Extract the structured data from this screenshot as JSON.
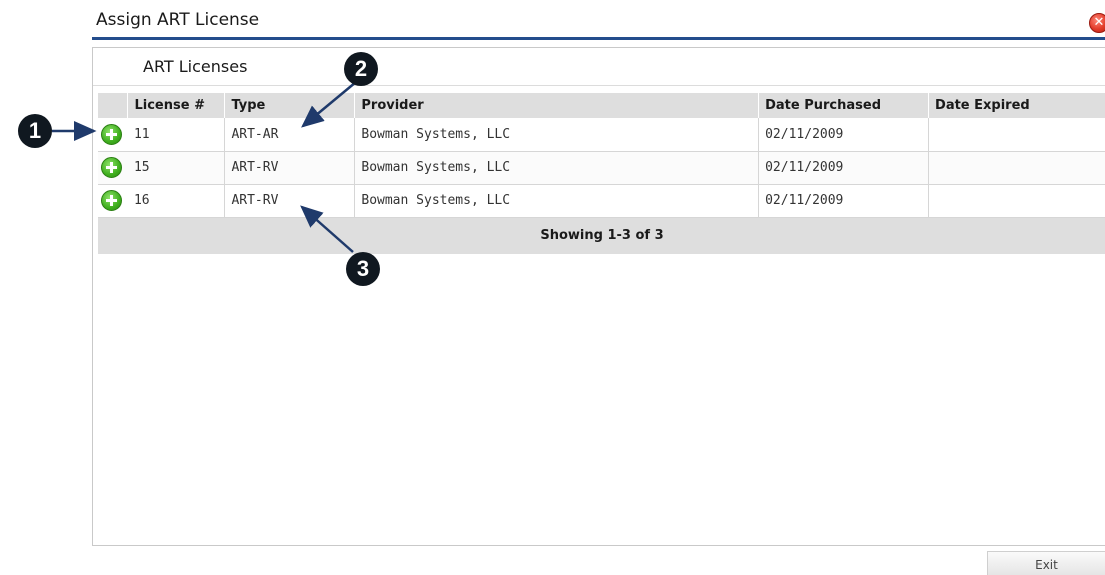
{
  "dialog": {
    "title": "Assign ART License",
    "close_icon": "close-x-icon",
    "close_color": "#e23b2a"
  },
  "panel": {
    "title": "ART Licenses"
  },
  "table": {
    "columns": [
      "",
      "License #",
      "Type",
      "Provider",
      "Date Purchased",
      "Date Expired"
    ],
    "rows": [
      {
        "icon": "add-plus-icon",
        "license": "11",
        "type": "ART-AR",
        "provider": "Bowman Systems, LLC",
        "date_purchased": "02/11/2009",
        "date_expired": ""
      },
      {
        "icon": "add-plus-icon",
        "license": "15",
        "type": "ART-RV",
        "provider": "Bowman Systems, LLC",
        "date_purchased": "02/11/2009",
        "date_expired": ""
      },
      {
        "icon": "add-plus-icon",
        "license": "16",
        "type": "ART-RV",
        "provider": "Bowman Systems, LLC",
        "date_purchased": "02/11/2009",
        "date_expired": ""
      }
    ],
    "pager_text": "Showing 1-3 of 3"
  },
  "footer": {
    "exit_label": "Exit"
  },
  "callouts": [
    {
      "label": "1"
    },
    {
      "label": "2"
    },
    {
      "label": "3"
    }
  ],
  "colors": {
    "title_rule": "#234d8c",
    "add_icon": "#3fae1e",
    "callout": "#101820"
  }
}
